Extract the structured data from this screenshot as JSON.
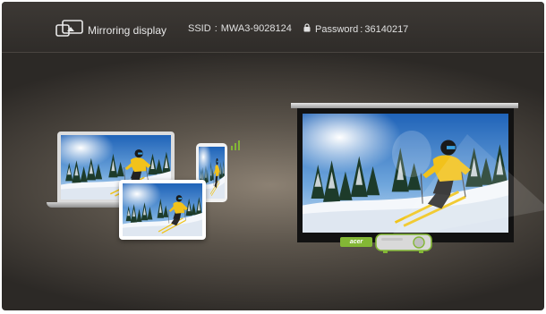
{
  "header": {
    "title": "Mirroring display",
    "ssid_label": "SSID",
    "ssid_separator": ":",
    "ssid_value": "MWA3-9028124",
    "password_label": "Password",
    "password_separator": ":",
    "password_value": "36140217"
  },
  "illustration": {
    "brand_tag": "acer",
    "accent_color": "#83b735",
    "devices": [
      "laptop",
      "smartphone",
      "tablet"
    ],
    "output": "projector"
  },
  "icons": {
    "mirror": "screen-mirror-icon",
    "lock": "lock-icon",
    "wifi": "wifi-signal-icon"
  }
}
